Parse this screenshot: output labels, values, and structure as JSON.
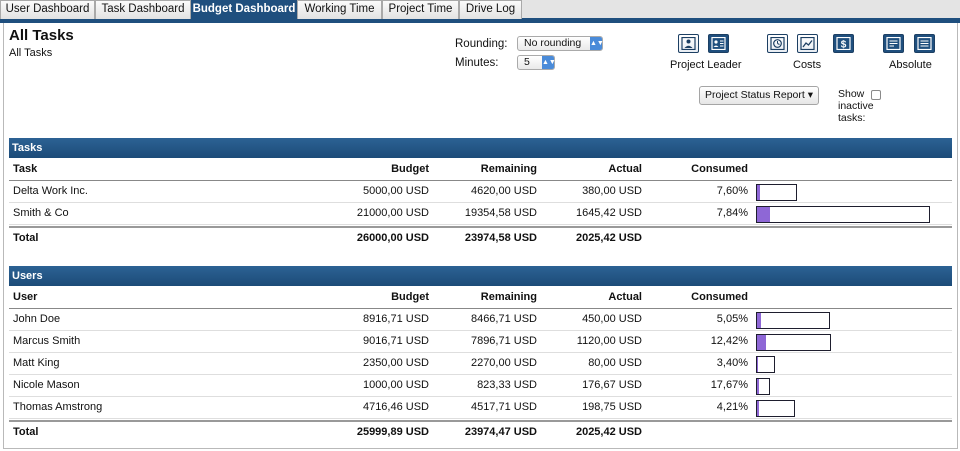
{
  "tabs": [
    {
      "label": "User Dashboard",
      "active": false
    },
    {
      "label": "Task Dashboard",
      "active": false
    },
    {
      "label": "Budget Dashboard",
      "active": true
    },
    {
      "label": "Working Time",
      "active": false
    },
    {
      "label": "Project Time",
      "active": false
    },
    {
      "label": "Drive Log",
      "active": false
    }
  ],
  "header": {
    "title": "All Tasks",
    "subtitle": "All Tasks"
  },
  "controls": {
    "rounding_label": "Rounding:",
    "rounding_value": "No rounding",
    "minutes_label": "Minutes:",
    "minutes_value": "5"
  },
  "view_groups": {
    "project_leader_label": "Project Leader",
    "costs_label": "Costs",
    "absolute_label": "Absolute",
    "icons": [
      "person-icon",
      "contact-card-icon",
      "clock-icon",
      "line-chart-icon",
      "dollar-icon",
      "document-icon",
      "list-icon"
    ]
  },
  "report_button_label": "Project Status Report ▾",
  "show_inactive": {
    "line1": "Show",
    "line2": "inactive",
    "line3": "tasks:",
    "checked": false
  },
  "tasks_table": {
    "title": "Tasks",
    "headers": {
      "name": "Task",
      "budget": "Budget",
      "remaining": "Remaining",
      "actual": "Actual",
      "consumed": "Consumed"
    },
    "rows": [
      {
        "name": "Delta Work Inc.",
        "budget": "5000,00 USD",
        "remaining": "4620,00 USD",
        "actual": "380,00 USD",
        "consumed": "7,60%",
        "consumed_fraction": 0.076,
        "budget_value": 5000
      },
      {
        "name": "Smith & Co",
        "budget": "21000,00 USD",
        "remaining": "19354,58 USD",
        "actual": "1645,42 USD",
        "consumed": "7,84%",
        "consumed_fraction": 0.0784,
        "budget_value": 21000
      }
    ],
    "total": {
      "name": "Total",
      "budget": "26000,00 USD",
      "remaining": "23974,58 USD",
      "actual": "2025,42 USD"
    }
  },
  "users_table": {
    "title": "Users",
    "headers": {
      "name": "User",
      "budget": "Budget",
      "remaining": "Remaining",
      "actual": "Actual",
      "consumed": "Consumed"
    },
    "rows": [
      {
        "name": "John Doe",
        "budget": "8916,71 USD",
        "remaining": "8466,71 USD",
        "actual": "450,00 USD",
        "consumed": "5,05%",
        "consumed_fraction": 0.0505,
        "budget_value": 8916.71
      },
      {
        "name": "Marcus Smith",
        "budget": "9016,71 USD",
        "remaining": "7896,71 USD",
        "actual": "1120,00 USD",
        "consumed": "12,42%",
        "consumed_fraction": 0.1242,
        "budget_value": 9016.71
      },
      {
        "name": "Matt King",
        "budget": "2350,00 USD",
        "remaining": "2270,00 USD",
        "actual": "80,00 USD",
        "consumed": "3,40%",
        "consumed_fraction": 0.034,
        "budget_value": 2350
      },
      {
        "name": "Nicole Mason",
        "budget": "1000,00 USD",
        "remaining": "823,33 USD",
        "actual": "176,67 USD",
        "consumed": "17,67%",
        "consumed_fraction": 0.1767,
        "budget_value": 1000
      },
      {
        "name": "Thomas Amstrong",
        "budget": "4716,46 USD",
        "remaining": "4517,71 USD",
        "actual": "198,75 USD",
        "consumed": "4,21%",
        "consumed_fraction": 0.0421,
        "budget_value": 4716.46
      }
    ],
    "total": {
      "name": "Total",
      "budget": "25999,89 USD",
      "remaining": "23974,47 USD",
      "actual": "2025,42 USD"
    }
  },
  "colors": {
    "accent": "#1f4f7e",
    "bar_fill": "#8e67d6",
    "select_arrow": "#4a8bd9"
  }
}
